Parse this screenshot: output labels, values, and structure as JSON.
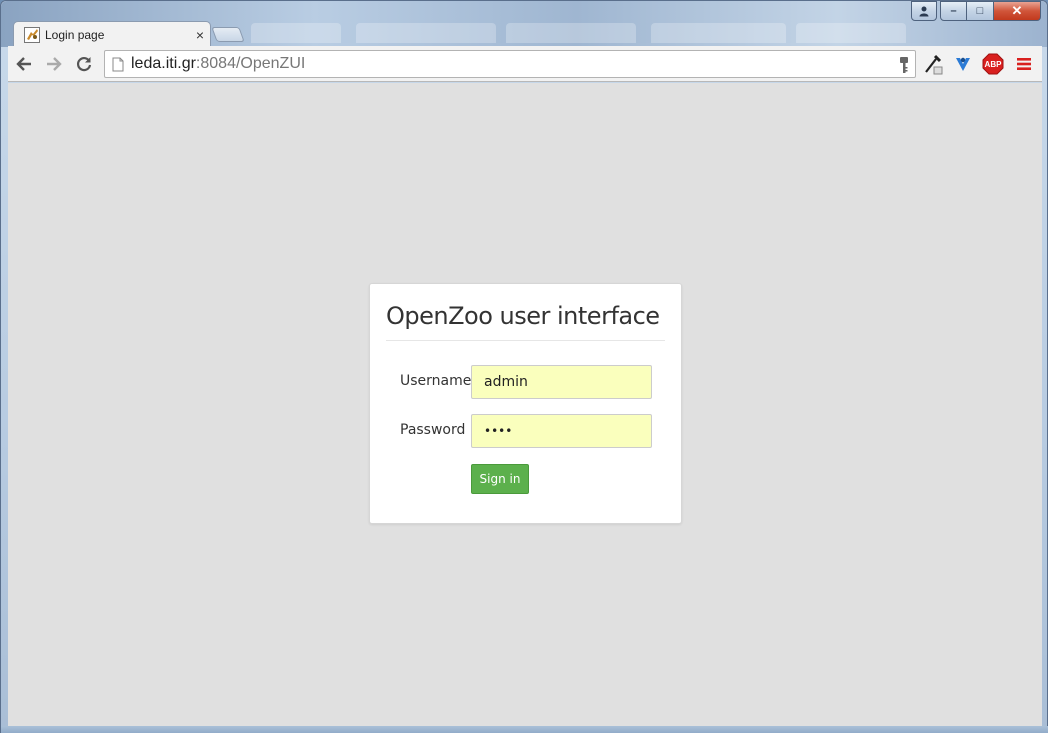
{
  "window": {
    "controls": {
      "minimize": "–",
      "maximize": "□",
      "close": "✕"
    }
  },
  "tabs": {
    "active_title": "Login page",
    "close_glyph": "×"
  },
  "toolbar": {
    "url_host": "leda.iti.gr",
    "url_rest": ":8084/OpenZUI",
    "icons": [
      "back-icon",
      "forward-icon",
      "reload-icon",
      "page-icon",
      "key-icon",
      "eyedropper-icon",
      "extension-icon",
      "adblock-icon",
      "menu-icon"
    ],
    "abp_label": "ABP"
  },
  "login": {
    "title": "OpenZoo user interface",
    "username_label": "Username",
    "username_value": "admin",
    "password_label": "Password",
    "password_value": "••••",
    "signin_label": "Sign in"
  },
  "colors": {
    "page_bg": "#e0e0e0",
    "autofill_bg": "#faffbd",
    "button_green": "#5cb04c",
    "close_red": "#c2391d"
  }
}
